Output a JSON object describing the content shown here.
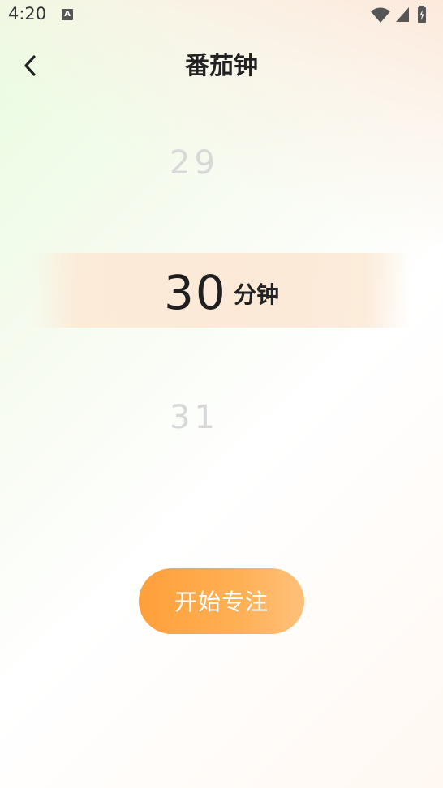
{
  "status_bar": {
    "time": "4:20",
    "notification_icon": "a-notification-icon",
    "wifi_icon": "wifi-icon",
    "signal_icon": "cell-signal-icon",
    "battery_icon": "battery-charging-icon"
  },
  "header": {
    "back_icon": "chevron-left-icon",
    "title": "番茄钟"
  },
  "picker": {
    "previous_value": "29",
    "selected_value": "30",
    "unit": "分钟",
    "next_value": "31"
  },
  "start_button": {
    "label": "开始专注",
    "color": "#ffa441"
  }
}
